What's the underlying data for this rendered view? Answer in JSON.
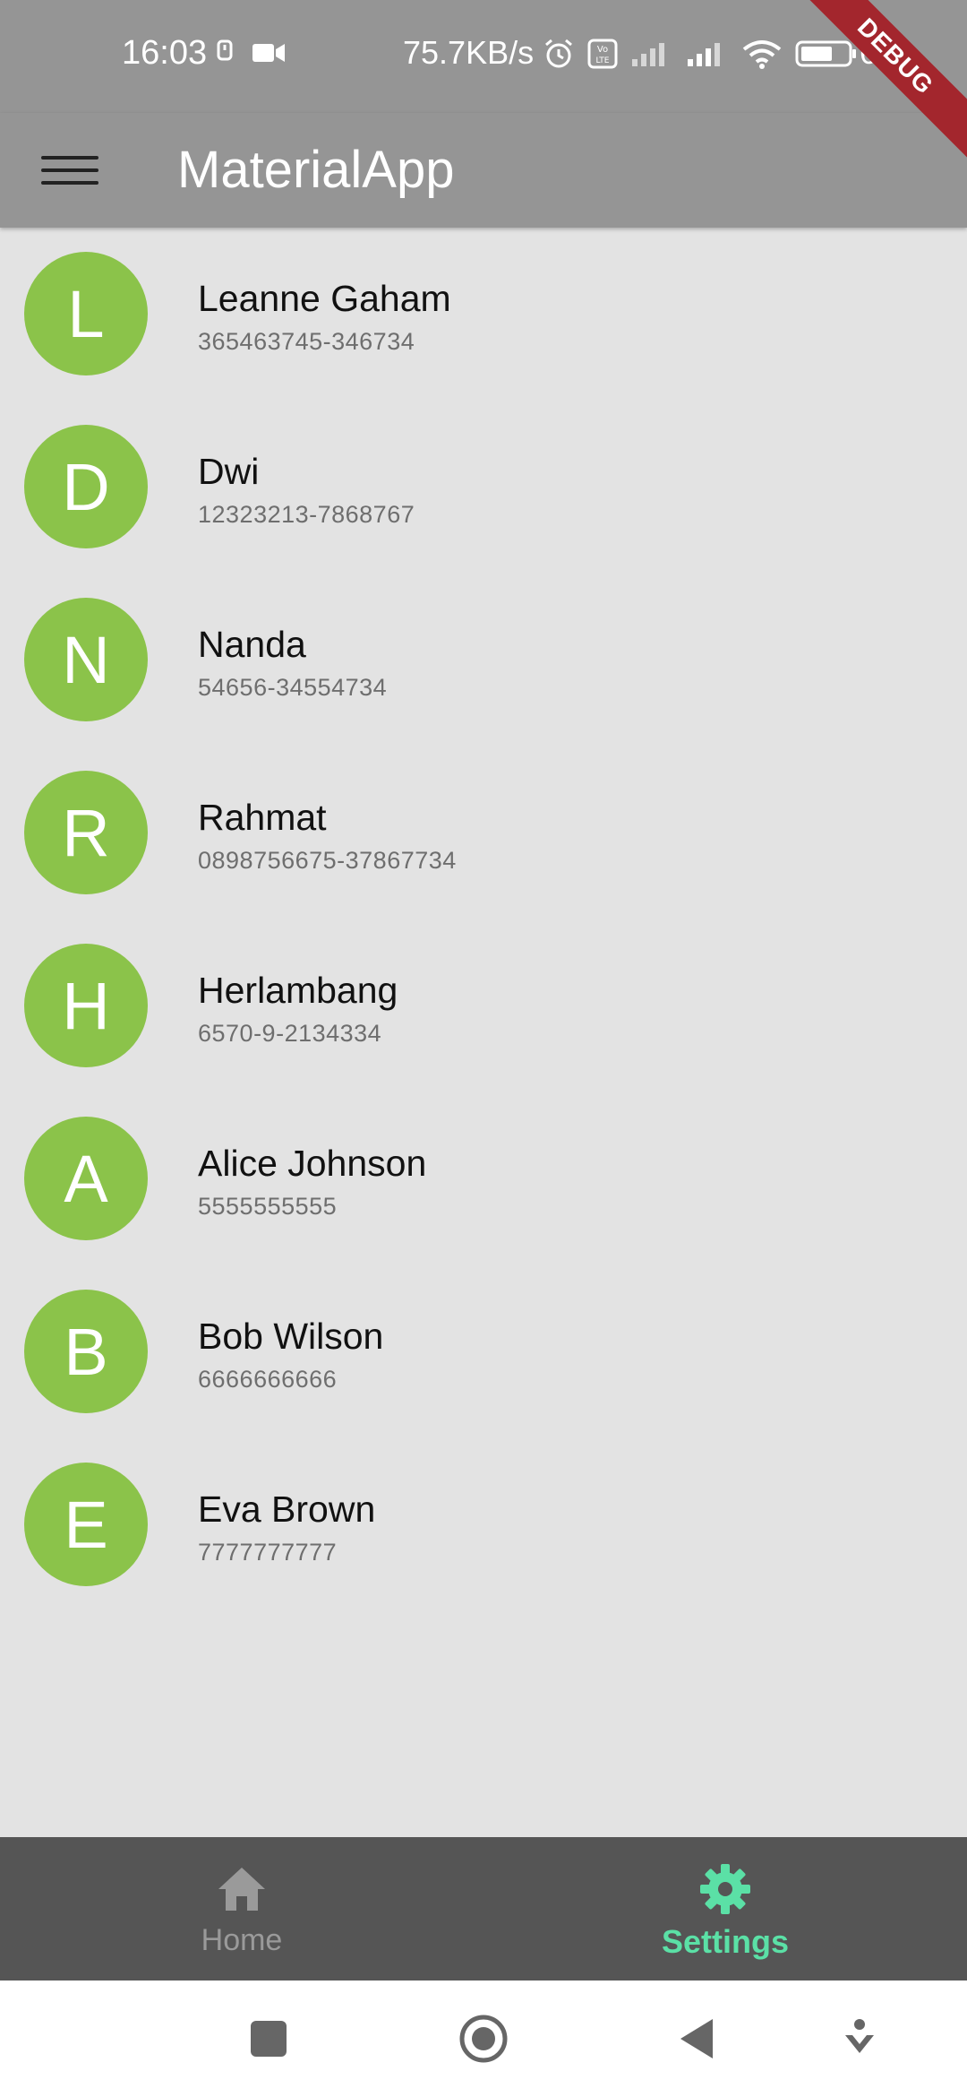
{
  "status_bar": {
    "time": "16:03",
    "network_speed": "75.7KB/s",
    "battery_percent": "64"
  },
  "debug_banner": "DEBUG",
  "app_bar": {
    "title": "MaterialApp",
    "menu_icon": "hamburger-menu-icon"
  },
  "contacts": [
    {
      "initial": "L",
      "name": "Leanne Gaham",
      "phone": "365463745-346734"
    },
    {
      "initial": "D",
      "name": "Dwi",
      "phone": "12323213-7868767"
    },
    {
      "initial": "N",
      "name": "Nanda",
      "phone": "54656-34554734"
    },
    {
      "initial": "R",
      "name": "Rahmat",
      "phone": "0898756675-37867734"
    },
    {
      "initial": "H",
      "name": "Herlambang",
      "phone": "6570-9-2134334"
    },
    {
      "initial": "A",
      "name": "Alice Johnson",
      "phone": "5555555555"
    },
    {
      "initial": "B",
      "name": "Bob Wilson",
      "phone": "6666666666"
    },
    {
      "initial": "E",
      "name": "Eva Brown",
      "phone": "7777777777"
    }
  ],
  "bottom_nav": {
    "tabs": [
      {
        "label": "Home",
        "icon": "home-icon",
        "active": false
      },
      {
        "label": "Settings",
        "icon": "gear-icon",
        "active": true
      }
    ]
  },
  "colors": {
    "app_bar": "#959595",
    "avatar": "#8bc34a",
    "bottom_nav_bg": "#555555",
    "active_tab": "#5be0a6",
    "inactive_tab": "#9a9a9a",
    "debug_ribbon": "#a3262d"
  }
}
